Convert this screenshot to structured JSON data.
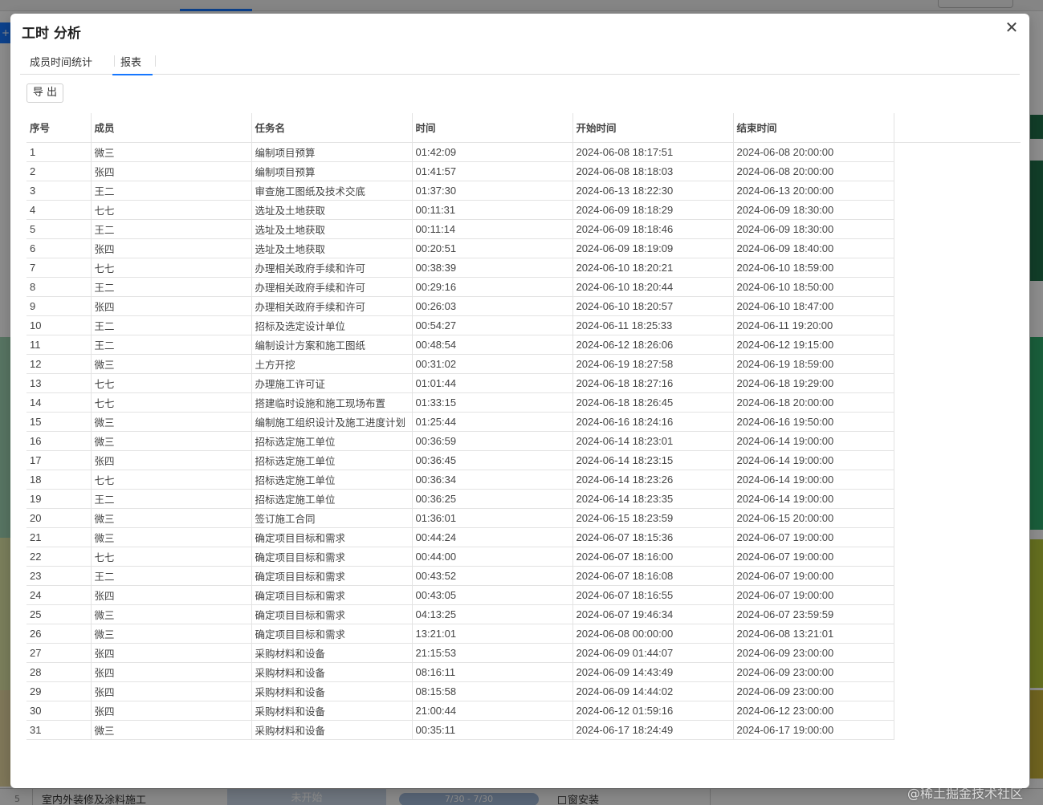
{
  "modal": {
    "title": "工时 分析",
    "close_icon": "close-icon",
    "tabs": [
      {
        "label": "成员时间统计",
        "active": false
      },
      {
        "label": "报表",
        "active": true
      }
    ],
    "export_label": "导 出"
  },
  "table": {
    "columns": [
      "序号",
      "成员",
      "任务名",
      "时间",
      "开始时间",
      "结束时间"
    ],
    "rows": [
      [
        "1",
        "微三",
        "编制项目预算",
        "01:42:09",
        "2024-06-08 18:17:51",
        "2024-06-08 20:00:00"
      ],
      [
        "2",
        "张四",
        "编制项目预算",
        "01:41:57",
        "2024-06-08 18:18:03",
        "2024-06-08 20:00:00"
      ],
      [
        "3",
        "王二",
        "审查施工图纸及技术交底",
        "01:37:30",
        "2024-06-13 18:22:30",
        "2024-06-13 20:00:00"
      ],
      [
        "4",
        "七七",
        "选址及土地获取",
        "00:11:31",
        "2024-06-09 18:18:29",
        "2024-06-09 18:30:00"
      ],
      [
        "5",
        "王二",
        "选址及土地获取",
        "00:11:14",
        "2024-06-09 18:18:46",
        "2024-06-09 18:30:00"
      ],
      [
        "6",
        "张四",
        "选址及土地获取",
        "00:20:51",
        "2024-06-09 18:19:09",
        "2024-06-09 18:40:00"
      ],
      [
        "7",
        "七七",
        "办理相关政府手续和许可",
        "00:38:39",
        "2024-06-10 18:20:21",
        "2024-06-10 18:59:00"
      ],
      [
        "8",
        "王二",
        "办理相关政府手续和许可",
        "00:29:16",
        "2024-06-10 18:20:44",
        "2024-06-10 18:50:00"
      ],
      [
        "9",
        "张四",
        "办理相关政府手续和许可",
        "00:26:03",
        "2024-06-10 18:20:57",
        "2024-06-10 18:47:00"
      ],
      [
        "10",
        "王二",
        "招标及选定设计单位",
        "00:54:27",
        "2024-06-11 18:25:33",
        "2024-06-11 19:20:00"
      ],
      [
        "11",
        "王二",
        "编制设计方案和施工图纸",
        "00:48:54",
        "2024-06-12 18:26:06",
        "2024-06-12 19:15:00"
      ],
      [
        "12",
        "微三",
        "土方开挖",
        "00:31:02",
        "2024-06-19 18:27:58",
        "2024-06-19 18:59:00"
      ],
      [
        "13",
        "七七",
        "办理施工许可证",
        "01:01:44",
        "2024-06-18 18:27:16",
        "2024-06-18 19:29:00"
      ],
      [
        "14",
        "七七",
        "搭建临时设施和施工现场布置",
        "01:33:15",
        "2024-06-18 18:26:45",
        "2024-06-18 20:00:00"
      ],
      [
        "15",
        "微三",
        "编制施工组织设计及施工进度计划",
        "01:25:44",
        "2024-06-16 18:24:16",
        "2024-06-16 19:50:00"
      ],
      [
        "16",
        "微三",
        "招标选定施工单位",
        "00:36:59",
        "2024-06-14 18:23:01",
        "2024-06-14 19:00:00"
      ],
      [
        "17",
        "张四",
        "招标选定施工单位",
        "00:36:45",
        "2024-06-14 18:23:15",
        "2024-06-14 19:00:00"
      ],
      [
        "18",
        "七七",
        "招标选定施工单位",
        "00:36:34",
        "2024-06-14 18:23:26",
        "2024-06-14 19:00:00"
      ],
      [
        "19",
        "王二",
        "招标选定施工单位",
        "00:36:25",
        "2024-06-14 18:23:35",
        "2024-06-14 19:00:00"
      ],
      [
        "20",
        "微三",
        "签订施工合同",
        "01:36:01",
        "2024-06-15 18:23:59",
        "2024-06-15 20:00:00"
      ],
      [
        "21",
        "微三",
        "确定项目目标和需求",
        "00:44:24",
        "2024-06-07 18:15:36",
        "2024-06-07 19:00:00"
      ],
      [
        "22",
        "七七",
        "确定项目目标和需求",
        "00:44:00",
        "2024-06-07 18:16:00",
        "2024-06-07 19:00:00"
      ],
      [
        "23",
        "王二",
        "确定项目目标和需求",
        "00:43:52",
        "2024-06-07 18:16:08",
        "2024-06-07 19:00:00"
      ],
      [
        "24",
        "张四",
        "确定项目目标和需求",
        "00:43:05",
        "2024-06-07 18:16:55",
        "2024-06-07 19:00:00"
      ],
      [
        "25",
        "微三",
        "确定项目目标和需求",
        "04:13:25",
        "2024-06-07 19:46:34",
        "2024-06-07 23:59:59"
      ],
      [
        "26",
        "微三",
        "确定项目目标和需求",
        "13:21:01",
        "2024-06-08 00:00:00",
        "2024-06-08 13:21:01"
      ],
      [
        "27",
        "张四",
        "采购材料和设备",
        "21:15:53",
        "2024-06-09 01:44:07",
        "2024-06-09 23:00:00"
      ],
      [
        "28",
        "张四",
        "采购材料和设备",
        "08:16:11",
        "2024-06-09 14:43:49",
        "2024-06-09 23:00:00"
      ],
      [
        "29",
        "张四",
        "采购材料和设备",
        "08:15:58",
        "2024-06-09 14:44:02",
        "2024-06-09 23:00:00"
      ],
      [
        "30",
        "张四",
        "采购材料和设备",
        "21:00:44",
        "2024-06-12 01:59:16",
        "2024-06-12 23:00:00"
      ],
      [
        "31",
        "微三",
        "采购材料和设备",
        "00:35:11",
        "2024-06-17 18:24:49",
        "2024-06-17 19:00:00"
      ]
    ]
  },
  "background": {
    "bottom_row": {
      "index": "5",
      "task": "室内外装修及涂料施工",
      "status": "未开始",
      "range": "7/30 - 7/30",
      "assignee": "窗安装"
    },
    "watermark": "@稀土掘金技术社区",
    "accent_color": "#1677ff"
  }
}
